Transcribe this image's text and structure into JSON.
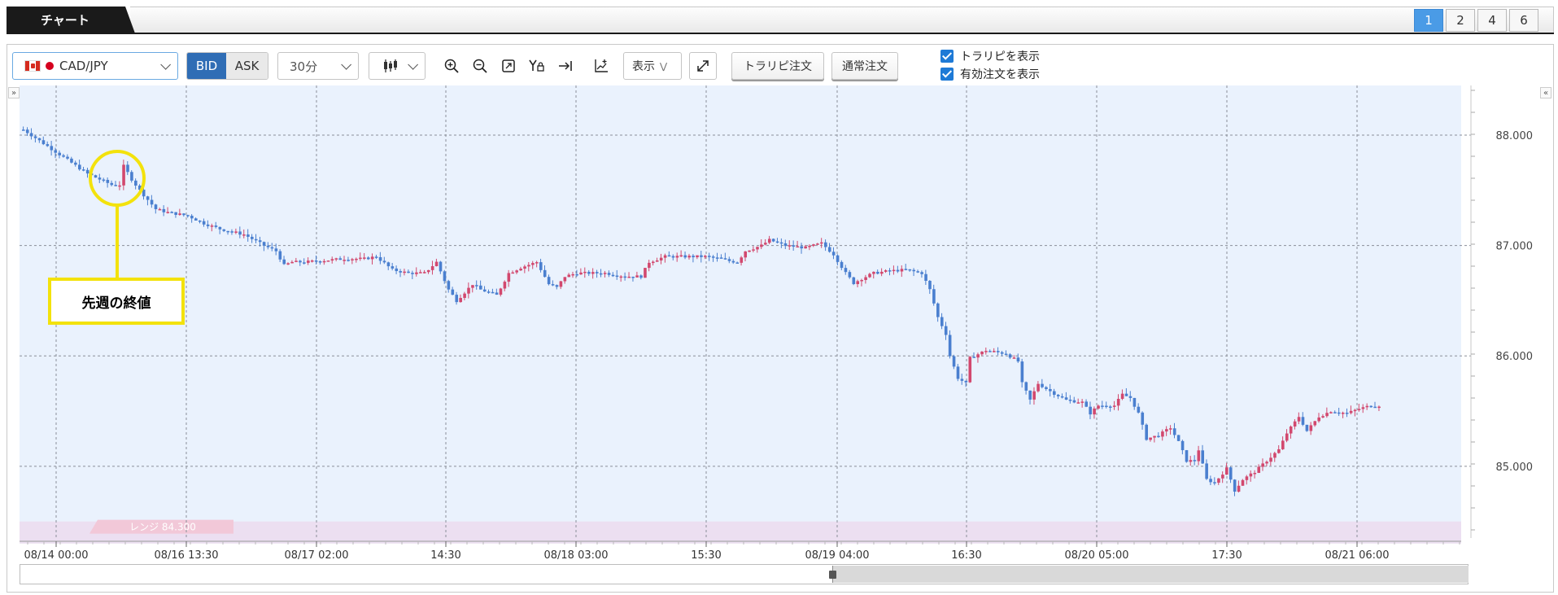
{
  "tabs": {
    "main": "チャート",
    "layouts": [
      "1",
      "2",
      "4",
      "6"
    ],
    "active_layout": "1"
  },
  "toolbar": {
    "symbol": "CAD/JPY",
    "bid": "BID",
    "ask": "ASK",
    "interval": "30分",
    "display": "表示",
    "traripi_order": "トラリピ注文",
    "normal_order": "通常注文",
    "show_traripi": "トラリピを表示",
    "show_active_orders": "有効注文を表示",
    "icons": [
      "zoom-in-icon",
      "zoom-out-icon",
      "fit-icon",
      "y-axis-lock-icon",
      "scroll-latest-icon",
      "indicator-icon",
      "fullscreen-icon"
    ]
  },
  "callout": {
    "text": "先週の終値"
  },
  "colors": {
    "up": "#d2486e",
    "down": "#4a7fcf",
    "plot_bg": "#eaf2fd",
    "range_band": "#ecdff1",
    "callout": "#f3e20c",
    "accent": "#4a9be6"
  },
  "chart_data": {
    "type": "candlestick",
    "ylim": [
      84.35,
      88.45
    ],
    "y_ticks": [
      "88.000",
      "87.000",
      "86.000",
      "85.000"
    ],
    "y_tick_values": [
      88.0,
      87.0,
      86.0,
      85.0
    ],
    "x_ticks": [
      "08/14 00:00",
      "08/16 13:30",
      "08/17 02:00",
      "14:30",
      "08/18 03:00",
      "15:30",
      "08/19 04:00",
      "16:30",
      "08/20 05:00",
      "17:30",
      "08/21 06:00"
    ],
    "candle_count": 220,
    "range_label": "レンジ 84.300",
    "range_band": [
      84.3,
      84.5
    ],
    "close_path": [
      [
        0,
        88.05
      ],
      [
        4,
        87.95
      ],
      [
        10,
        87.8
      ],
      [
        16,
        87.65
      ],
      [
        22,
        87.55
      ],
      [
        24,
        87.55
      ],
      [
        25,
        87.72
      ],
      [
        27,
        87.6
      ],
      [
        29,
        87.5
      ],
      [
        33,
        87.33
      ],
      [
        36,
        87.3
      ],
      [
        41,
        87.27
      ],
      [
        45,
        87.2
      ],
      [
        49,
        87.15
      ],
      [
        55,
        87.1
      ],
      [
        60,
        87.0
      ],
      [
        63,
        86.95
      ],
      [
        65,
        86.82
      ],
      [
        67,
        86.85
      ],
      [
        70,
        86.85
      ],
      [
        80,
        86.88
      ],
      [
        85,
        86.88
      ],
      [
        88,
        86.9
      ],
      [
        92,
        86.78
      ],
      [
        96,
        86.75
      ],
      [
        100,
        86.75
      ],
      [
        103,
        86.85
      ],
      [
        106,
        86.6
      ],
      [
        108,
        86.5
      ],
      [
        112,
        86.65
      ],
      [
        114,
        86.6
      ],
      [
        118,
        86.55
      ],
      [
        121,
        86.75
      ],
      [
        124,
        86.8
      ],
      [
        128,
        86.85
      ],
      [
        131,
        86.65
      ],
      [
        133,
        86.62
      ],
      [
        135,
        86.72
      ],
      [
        138,
        86.75
      ],
      [
        145,
        86.75
      ],
      [
        150,
        86.72
      ],
      [
        154,
        86.72
      ],
      [
        156,
        86.85
      ],
      [
        160,
        86.9
      ],
      [
        165,
        86.9
      ],
      [
        170,
        86.9
      ],
      [
        174,
        86.88
      ],
      [
        176,
        86.86
      ],
      [
        178,
        86.85
      ],
      [
        180,
        86.95
      ],
      [
        184,
        87.0
      ],
      [
        186,
        87.05
      ],
      [
        190,
        87.0
      ],
      [
        195,
        86.98
      ],
      [
        199,
        87.02
      ],
      [
        202,
        86.92
      ],
      [
        205,
        86.75
      ],
      [
        207,
        86.66
      ],
      [
        209,
        86.7
      ],
      [
        212,
        86.75
      ],
      [
        216,
        86.77
      ],
      [
        220,
        86.78
      ],
      [
        224,
        86.75
      ],
      [
        226,
        86.6
      ],
      [
        228,
        86.35
      ],
      [
        230,
        86.2
      ],
      [
        231,
        86.0
      ],
      [
        233,
        85.8
      ],
      [
        235,
        85.75
      ],
      [
        236,
        85.98
      ],
      [
        240,
        86.05
      ],
      [
        245,
        86.02
      ],
      [
        248,
        85.95
      ],
      [
        249,
        85.75
      ],
      [
        251,
        85.6
      ],
      [
        253,
        85.75
      ],
      [
        256,
        85.68
      ],
      [
        260,
        85.6
      ],
      [
        264,
        85.58
      ],
      [
        266,
        85.48
      ],
      [
        268,
        85.55
      ],
      [
        272,
        85.55
      ],
      [
        274,
        85.65
      ],
      [
        276,
        85.62
      ],
      [
        278,
        85.48
      ],
      [
        280,
        85.25
      ],
      [
        283,
        85.28
      ],
      [
        286,
        85.35
      ],
      [
        288,
        85.22
      ],
      [
        290,
        85.05
      ],
      [
        292,
        85.05
      ],
      [
        293,
        85.15
      ],
      [
        295,
        84.88
      ],
      [
        297,
        84.85
      ],
      [
        300,
        84.98
      ],
      [
        302,
        84.78
      ],
      [
        304,
        84.88
      ],
      [
        307,
        84.95
      ],
      [
        310,
        85.05
      ],
      [
        313,
        85.15
      ],
      [
        315,
        85.3
      ],
      [
        318,
        85.45
      ],
      [
        320,
        85.32
      ],
      [
        323,
        85.45
      ],
      [
        326,
        85.5
      ],
      [
        330,
        85.48
      ],
      [
        333,
        85.52
      ],
      [
        336,
        85.55
      ],
      [
        338,
        85.55
      ]
    ]
  }
}
